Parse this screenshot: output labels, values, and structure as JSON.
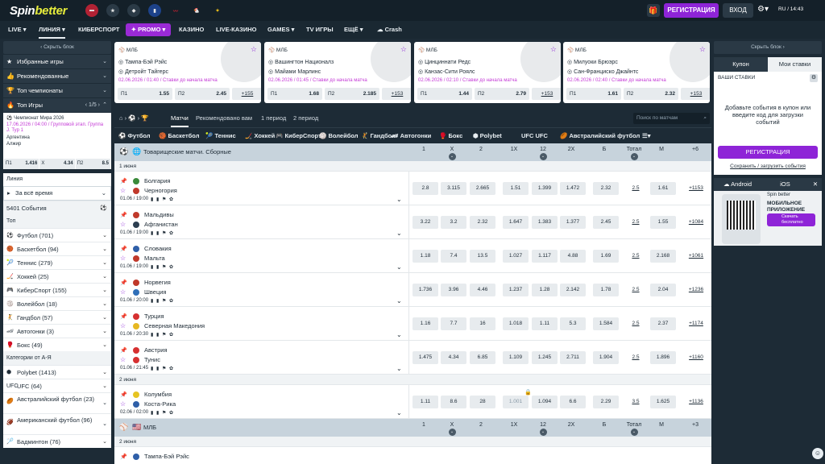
{
  "brand": {
    "part1": "Spin",
    "part2": "better"
  },
  "topbar": {
    "register": "РЕГИСТРАЦИЯ",
    "login": "ВХОД",
    "lang_time": "RU / 14:43"
  },
  "nav": {
    "live": "LIVE",
    "liniya": "ЛИНИЯ",
    "cyber": "КИБЕРСПОРТ",
    "promo": "PROMO",
    "casino": "КАЗИНО",
    "livecasino": "LIVE-КАЗИНО",
    "games": "GAMES",
    "tv": "TV ИГРЫ",
    "more": "ЕЩЁ",
    "crash": "Crash"
  },
  "left": {
    "hide": "Скрыть блок",
    "fav": "Избранные игры",
    "rec": "Рекомендованные",
    "topchamp": "Топ чемпионаты",
    "topgames": "Топ Игры",
    "pager": "1/5",
    "card": {
      "league": "Чемпионат Мира 2026",
      "date": "17.06.2026 / 04:00 / Групповой этап. Группа J. Тур 1",
      "t1": "Аргентина",
      "t2": "Алжир",
      "p1": "П1",
      "v1": "1.416",
      "x": "X",
      "vx": "4.34",
      "p2": "П2",
      "v2": "8.5"
    },
    "liniya": "Линия",
    "period": "За всё время",
    "events": "5401 События",
    "top": "Топ",
    "sports": [
      {
        "n": "Футбол (701)",
        "i": "⚽"
      },
      {
        "n": "Баскетбол (94)",
        "i": "🏀"
      },
      {
        "n": "Теннис (279)",
        "i": "🎾"
      },
      {
        "n": "Хоккей (25)",
        "i": "🏒"
      },
      {
        "n": "КиберСпорт (155)",
        "i": "🎮"
      },
      {
        "n": "Волейбол (18)",
        "i": "🏐"
      },
      {
        "n": "Гандбол (57)",
        "i": "🤾"
      },
      {
        "n": "Автогонки (3)",
        "i": "🏎"
      },
      {
        "n": "Бокс (49)",
        "i": "🥊"
      }
    ],
    "cat": "Категории от А-Я",
    "cats": [
      {
        "n": "Polybet (1413)",
        "i": "⬢"
      },
      {
        "n": "UFC (64)",
        "i": "UFC"
      }
    ],
    "cats2": [
      {
        "n": "Австралийский футбол (23)",
        "i": "🏉"
      },
      {
        "n": "Американский футбол (96)",
        "i": "🏈"
      }
    ],
    "last": "Бадминтон (76)"
  },
  "cards": [
    {
      "lg": "МЛБ",
      "t1": "Тампа-Бэй Рэйс",
      "t2": "Детройт Тайгерс",
      "dt": "02.06.2026 / 01:40 / Ставки до начала матча",
      "o": [
        [
          "П1",
          "1.55"
        ],
        [
          "П2",
          "2.45"
        ]
      ],
      "more": "+155"
    },
    {
      "lg": "МЛБ",
      "t1": "Вашингтон Националз",
      "t2": "Майами Марлинс",
      "dt": "02.06.2026 / 01:45 / Ставки до начала матча",
      "o": [
        [
          "П1",
          "1.68"
        ],
        [
          "П2",
          "2.185"
        ]
      ],
      "more": "+153"
    },
    {
      "lg": "МЛБ",
      "t1": "Цинциннати Редс",
      "t2": "Канзас-Сити Роялс",
      "dt": "02.06.2026 / 02:10 / Ставки до начала матча",
      "o": [
        [
          "П1",
          "1.44"
        ],
        [
          "П2",
          "2.79"
        ]
      ],
      "more": "+153"
    },
    {
      "lg": "МЛБ",
      "t1": "Милуоки Брюэрс",
      "t2": "Сан-Франциско Джайнтс",
      "dt": "02.06.2026 / 02:40 / Ставки до начала матча",
      "o": [
        [
          "П1",
          "1.61"
        ],
        [
          "П2",
          "2.32"
        ]
      ],
      "more": "+153"
    }
  ],
  "tabs": {
    "matches": "Матчи",
    "rec": "Рекомендовано вам",
    "p1": "1 период",
    "p2": "2 период",
    "search": "Поиск по матчам"
  },
  "sportsbar": [
    "Футбол",
    "Баскетбол",
    "Теннис",
    "Хоккей",
    "КиберСпорт",
    "Волейбол",
    "Гандбол",
    "Автогонки",
    "Бокс",
    "Polybet",
    "UFC",
    "Австралийский футбол"
  ],
  "cols": [
    "1",
    "X",
    "2",
    "1X",
    "12",
    "2X",
    "Б",
    "Тотал",
    "М"
  ],
  "league1": {
    "name": "Товарищеские матчи. Сборные",
    "more": "+6"
  },
  "date1": "1 июня",
  "events": [
    {
      "a": "Болгария",
      "b": "Черногория",
      "t": "01.06 / 19:00",
      "o": [
        "2.8",
        "3.115",
        "2.665",
        "1.51",
        "1.399",
        "1.472",
        "2.32",
        "2.5",
        "1.61"
      ],
      "m": "+1153",
      "fa": "#3a8a3a",
      "fb": "#c0392b"
    },
    {
      "a": "Мальдивы",
      "b": "Афганистан",
      "t": "01.06 / 19:00",
      "o": [
        "3.22",
        "3.2",
        "2.32",
        "1.647",
        "1.383",
        "1.377",
        "2.45",
        "2.5",
        "1.55"
      ],
      "m": "+1084",
      "fa": "#c0392b",
      "fb": "#2c3e50"
    },
    {
      "a": "Словакия",
      "b": "Мальта",
      "t": "01.06 / 19:00",
      "o": [
        "1.18",
        "7.4",
        "13.5",
        "1.027",
        "1.117",
        "4.88",
        "1.69",
        "2.5",
        "2.168"
      ],
      "m": "+1061",
      "fa": "#2f5fa8",
      "fb": "#c0392b"
    },
    {
      "a": "Норвегия",
      "b": "Швеция",
      "t": "01.06 / 20:00",
      "o": [
        "1.736",
        "3.96",
        "4.46",
        "1.237",
        "1.28",
        "2.142",
        "1.78",
        "2.5",
        "2.04"
      ],
      "m": "+1236",
      "fa": "#c0392b",
      "fb": "#2f6fb8"
    },
    {
      "a": "Турция",
      "b": "Северная Македония",
      "t": "01.06 / 20:30",
      "o": [
        "1.16",
        "7.7",
        "16",
        "1.018",
        "1.11",
        "5.3",
        "1.584",
        "2.5",
        "2.37"
      ],
      "m": "+1174",
      "fa": "#d63031",
      "fb": "#e6b822"
    },
    {
      "a": "Австрия",
      "b": "Тунис",
      "t": "01.06 / 21:45",
      "o": [
        "1.475",
        "4.34",
        "6.85",
        "1.109",
        "1.245",
        "2.711",
        "1.904",
        "2.5",
        "1.896"
      ],
      "m": "+1160",
      "fa": "#d63031",
      "fb": "#d63031"
    }
  ],
  "date2": "2 июня",
  "event7": {
    "a": "Колумбия",
    "b": "Коста-Рика",
    "t": "02.06 / 02:00",
    "o": [
      "1.11",
      "8.6",
      "28",
      "1.001",
      "1.094",
      "6.6",
      "2.29",
      "3.5",
      "1.625"
    ],
    "m": "+1136",
    "fa": "#e6c422",
    "fb": "#2f5fa8"
  },
  "league2": {
    "name": "МЛБ",
    "more": "+3"
  },
  "date3": "2 июня",
  "event8": {
    "a": "Тампа-Бэй Рэйс"
  },
  "right": {
    "hide": "Скрыть блок",
    "coupon": "Купон",
    "mybets": "Мои ставки",
    "yourbets": "ВАШИ СТАВКИ",
    "addtxt": "Добавьте события в купон или введите код для загрузки событий",
    "register": "РЕГИСТРАЦИЯ",
    "save": "Сохранить / загрузить события",
    "android": "Android",
    "ios": "iOS",
    "appbrand": "Spin better",
    "apptitle": "МОБИЛЬНОЕ ПРИЛОЖЕНИЕ",
    "appbtn": "Скачать бесплатно"
  }
}
